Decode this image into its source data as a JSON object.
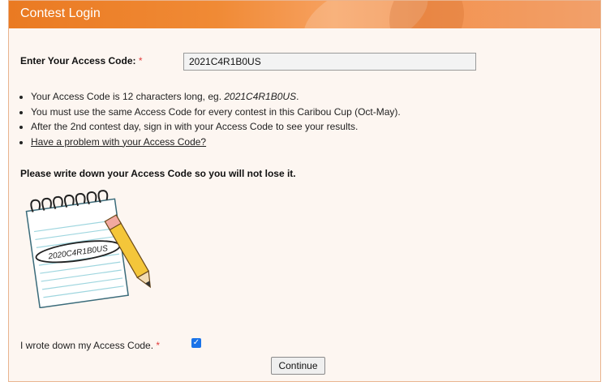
{
  "header": {
    "title": "Contest Login"
  },
  "access_code": {
    "label": "Enter Your Access Code:",
    "required_mark": "*",
    "value": "2021C4R1B0US"
  },
  "info": {
    "item1_prefix": "Your Access Code is 12 characters long, eg. ",
    "item1_example": "2021C4R1B0US",
    "item1_suffix": ".",
    "item2": "You must use the same Access Code for every contest in this Caribou Cup (Oct-May).",
    "item3": "After the 2nd contest day, sign in with your Access Code to see your results.",
    "item4_link": "Have a problem with your Access Code?"
  },
  "warning": "Please write down your Access Code so you will not lose it.",
  "illustration": {
    "code_text": "2020C4R1B0US"
  },
  "confirm": {
    "label": "I wrote down my Access Code.",
    "required_mark": "*",
    "checked": true
  },
  "continue_label": "Continue",
  "colors": {
    "header": "#ea7a22",
    "panel_bg": "#fdf6f1",
    "required": "#e23b3b",
    "checkbox": "#1a73e8"
  }
}
